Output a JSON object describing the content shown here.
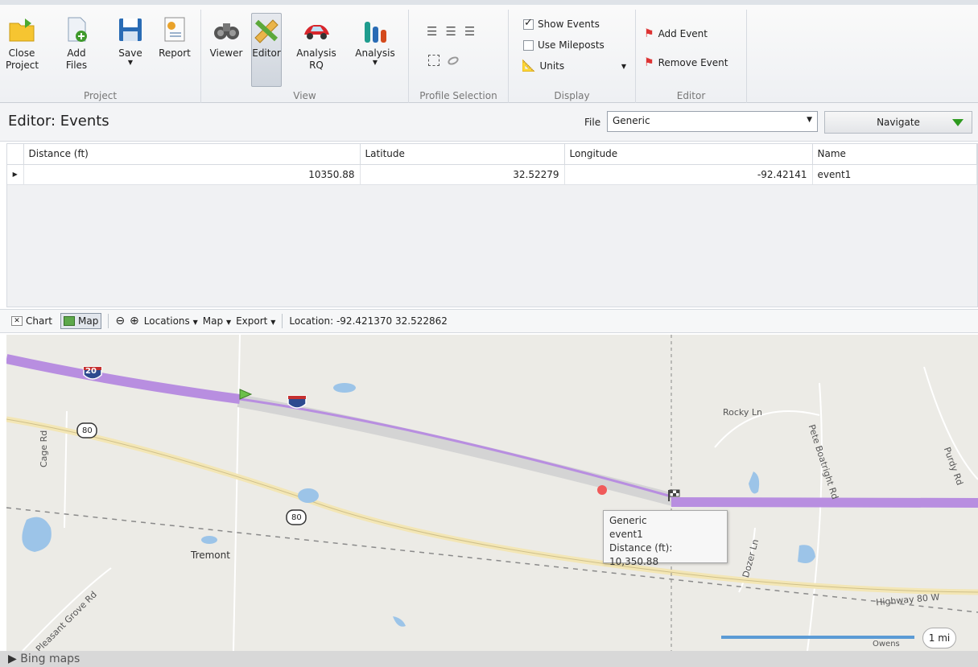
{
  "ribbon": {
    "groups": {
      "project": "Project",
      "view": "View",
      "profile_selection": "Profile Selection",
      "display": "Display",
      "editor": "Editor"
    },
    "buttons": {
      "close_project": "Close Project",
      "add_files": "Add Files",
      "save": "Save",
      "report": "Report",
      "viewer": "Viewer",
      "editor": "Editor",
      "analysis_rq": "Analysis RQ",
      "analysis": "Analysis"
    },
    "display": {
      "show_events": "Show Events",
      "use_mileposts": "Use Mileposts",
      "units": "Units"
    },
    "editor": {
      "add_event": "Add Event",
      "remove_event": "Remove Event"
    }
  },
  "editor_panel": {
    "title": "Editor: Events",
    "file_label": "File",
    "file_value": "Generic",
    "navigate_label": "Navigate"
  },
  "grid": {
    "columns": [
      "Distance (ft)",
      "Latitude",
      "Longitude",
      "Name"
    ],
    "rows": [
      {
        "distance": "10350.88",
        "latitude": "32.52279",
        "longitude": "-92.42141",
        "name": "event1"
      }
    ]
  },
  "map_toolbar": {
    "chart": "Chart",
    "map": "Map",
    "locations": "Locations",
    "map_menu": "Map",
    "export": "Export",
    "location": "Location: -92.421370 32.522862"
  },
  "map": {
    "labels": {
      "i20_a": "20",
      "us80_a": "80",
      "us80_b": "80",
      "rocky_ln": "Rocky Ln",
      "pete_boatright": "Pete Boatright Rd",
      "purdy_rd": "Purdy Rd",
      "cage_rd": "Cage Rd",
      "tremont": "Tremont",
      "dozer_ln": "Dozer Ln",
      "highway_80w": "Highway 80 W",
      "pleasant_grove": "Pleasant Grove Rd",
      "owens": "Owens"
    },
    "tooltip": {
      "line1": "Generic",
      "line2": "event1",
      "line3": "Distance (ft): 10,350.88"
    },
    "scale": "1 mi",
    "attribution": "Bing maps"
  },
  "colors": {
    "route": "#b88ee0",
    "selection": "#d6d6d6",
    "event_marker": "#f05a5a",
    "start_flag": "#6cc04a"
  }
}
